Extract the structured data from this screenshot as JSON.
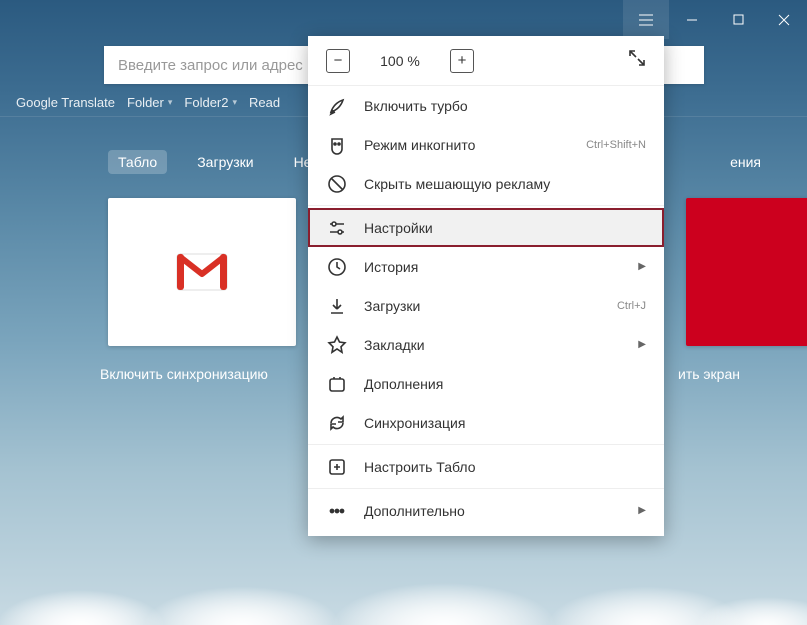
{
  "titlebar": {
    "menu_title": "Меню"
  },
  "addressbar": {
    "placeholder": "Введите запрос или адрес"
  },
  "bookmarks": {
    "items": [
      "Google Translate",
      "Folder",
      "Folder2",
      "Read"
    ]
  },
  "tabs": {
    "tablo": "Табло",
    "downloads": "Загрузки",
    "recent": "Недавно",
    "extensions_tail": "ения"
  },
  "tiles": {
    "gmail_alt": "Gmail"
  },
  "captions": {
    "left": "Включить синхронизацию",
    "right_tail": "ить экран"
  },
  "menu": {
    "zoom": {
      "minus": "−",
      "value": "100 %",
      "plus": "+"
    },
    "turbo": "Включить турбо",
    "incognito": {
      "label": "Режим инкогнито",
      "hint": "Ctrl+Shift+N"
    },
    "hide_ads": "Скрыть мешающую рекламу",
    "settings": "Настройки",
    "history": "История",
    "downloads": {
      "label": "Загрузки",
      "hint": "Ctrl+J"
    },
    "bookmarks": "Закладки",
    "addons": "Дополнения",
    "sync": "Синхронизация",
    "configure_tablo": "Настроить Табло",
    "more": "Дополнительно"
  }
}
